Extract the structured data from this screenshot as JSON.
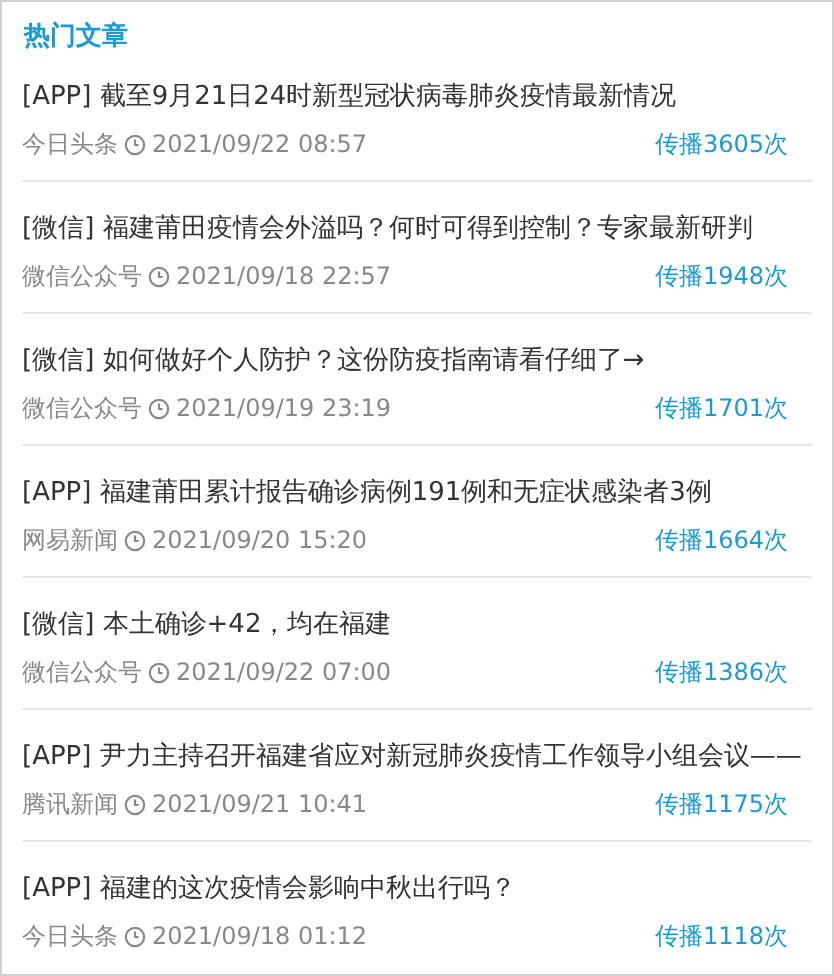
{
  "title": "热门文章",
  "articles": [
    {
      "tag": "[APP]",
      "headline": "截至9月21日24时新型冠状病毒肺炎疫情最新情况",
      "source": "今日头条",
      "time": "2021/09/22 08:57",
      "spread": "传播3605次"
    },
    {
      "tag": "[微信]",
      "headline": "福建莆田疫情会外溢吗？何时可得到控制？专家最新研判",
      "source": "微信公众号",
      "time": "2021/09/18 22:57",
      "spread": "传播1948次"
    },
    {
      "tag": "[微信]",
      "headline": "如何做好个人防护？这份防疫指南请看仔细了→",
      "source": "微信公众号",
      "time": "2021/09/19 23:19",
      "spread": "传播1701次"
    },
    {
      "tag": "[APP]",
      "headline": "福建莆田累计报告确诊病例191例和无症状感染者3例",
      "source": "网易新闻",
      "time": "2021/09/20 15:20",
      "spread": "传播1664次"
    },
    {
      "tag": "[微信]",
      "headline": "本土确诊+42，均在福建",
      "source": "微信公众号",
      "time": "2021/09/22 07:00",
      "spread": "传播1386次"
    },
    {
      "tag": "[APP]",
      "headline": "尹力主持召开福建省应对新冠肺炎疫情工作领导小组会议——",
      "source": "腾讯新闻",
      "time": "2021/09/21 10:41",
      "spread": "传播1175次"
    },
    {
      "tag": "[APP]",
      "headline": "福建的这次疫情会影响中秋出行吗？",
      "source": "今日头条",
      "time": "2021/09/18 01:12",
      "spread": "传播1118次"
    }
  ]
}
